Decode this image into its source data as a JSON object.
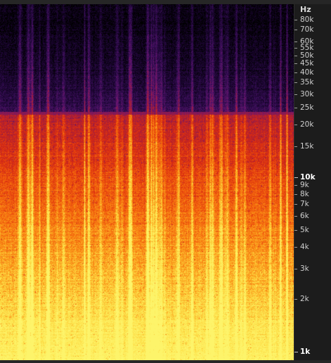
{
  "axis": {
    "unit": "Hz",
    "scale": "log",
    "ticks": [
      {
        "label": "80k",
        "hz": 80000,
        "bold": false
      },
      {
        "label": "70k",
        "hz": 70000,
        "bold": false
      },
      {
        "label": "60k",
        "hz": 60000,
        "bold": false
      },
      {
        "label": "55k",
        "hz": 55000,
        "bold": false
      },
      {
        "label": "50k",
        "hz": 50000,
        "bold": false
      },
      {
        "label": "45k",
        "hz": 45000,
        "bold": false
      },
      {
        "label": "40k",
        "hz": 40000,
        "bold": false
      },
      {
        "label": "35k",
        "hz": 35000,
        "bold": false
      },
      {
        "label": "30k",
        "hz": 30000,
        "bold": false
      },
      {
        "label": "25k",
        "hz": 25000,
        "bold": false
      },
      {
        "label": "20k",
        "hz": 20000,
        "bold": false
      },
      {
        "label": "15k",
        "hz": 15000,
        "bold": false
      },
      {
        "label": "10k",
        "hz": 10000,
        "bold": true
      },
      {
        "label": "9k",
        "hz": 9000,
        "bold": false
      },
      {
        "label": "8k",
        "hz": 8000,
        "bold": false
      },
      {
        "label": "7k",
        "hz": 7000,
        "bold": false
      },
      {
        "label": "6k",
        "hz": 6000,
        "bold": false
      },
      {
        "label": "5k",
        "hz": 5000,
        "bold": false
      },
      {
        "label": "4k",
        "hz": 4000,
        "bold": false
      },
      {
        "label": "3k",
        "hz": 3000,
        "bold": false
      },
      {
        "label": "2k",
        "hz": 2000,
        "bold": false
      },
      {
        "label": "1k",
        "hz": 1000,
        "bold": true
      }
    ]
  },
  "spectrogram": {
    "colormap": [
      "#000000",
      "#1a0530",
      "#3b0f5a",
      "#6a1570",
      "#a51d3a",
      "#d82a12",
      "#f25e0c",
      "#fb9c1a",
      "#fde048",
      "#fdf46a"
    ],
    "cutoff_hz": 23000
  }
}
